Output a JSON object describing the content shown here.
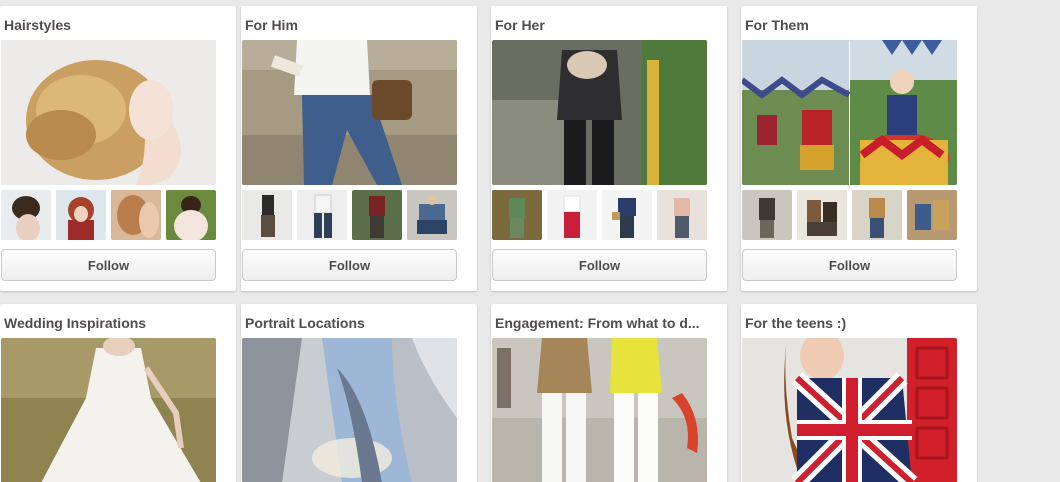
{
  "boards": [
    {
      "title": "Hairstyles",
      "follow_label": "Follow"
    },
    {
      "title": "For Him",
      "follow_label": "Follow"
    },
    {
      "title": "For Her",
      "follow_label": "Follow"
    },
    {
      "title": "For Them",
      "follow_label": "Follow"
    },
    {
      "title": "Wedding Inspirations"
    },
    {
      "title": "Portrait Locations"
    },
    {
      "title": "Engagement: From what to d..."
    },
    {
      "title": "For the teens :)"
    }
  ],
  "colors": {
    "background": "#e9e9e9",
    "card": "#ffffff",
    "title_text": "#524d4d",
    "button_border": "#c9c9c9"
  }
}
